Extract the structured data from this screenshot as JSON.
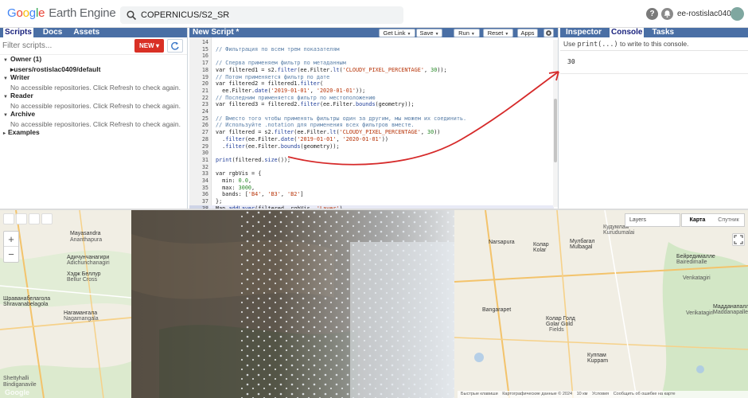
{
  "header": {
    "logo_letters": [
      "G",
      "o",
      "o",
      "g",
      "l",
      "e"
    ],
    "product": "Earth Engine",
    "search_value": "COPERNICUS/S2_SR",
    "user_name": "ee-rostislac0409",
    "help_icon": "help-icon",
    "notifications_icon": "bell-icon"
  },
  "left": {
    "tabs": [
      "Scripts",
      "Docs",
      "Assets"
    ],
    "filter_placeholder": "Filter scripts...",
    "new_button": "NEW",
    "tree": [
      {
        "type": "sec",
        "arrow": "▼",
        "label": "Owner (1)"
      },
      {
        "type": "item",
        "arrow": "▸",
        "label": "users/rostislac0409/default"
      },
      {
        "type": "sec",
        "arrow": "▼",
        "label": "Writer"
      },
      {
        "type": "empty",
        "label": "No accessible repositories. Click Refresh to check again."
      },
      {
        "type": "sec",
        "arrow": "▼",
        "label": "Reader"
      },
      {
        "type": "empty",
        "label": "No accessible repositories. Click Refresh to check again."
      },
      {
        "type": "sec",
        "arrow": "▼",
        "label": "Archive"
      },
      {
        "type": "empty",
        "label": "No accessible repositories. Click Refresh to check again."
      },
      {
        "type": "sec",
        "arrow": "▸",
        "label": "Examples"
      }
    ]
  },
  "editor": {
    "title": "New Script *",
    "buttons": {
      "get_link": "Get Link",
      "save": "Save",
      "run": "Run",
      "reset": "Reset",
      "apps": "Apps"
    },
    "lines": [
      {
        "n": "14",
        "segs": []
      },
      {
        "n": "15",
        "segs": [
          [
            "cm",
            "// Фильтрация по всем трем показателям"
          ]
        ]
      },
      {
        "n": "16",
        "segs": []
      },
      {
        "n": "17",
        "segs": [
          [
            "cm",
            "// Сперва применяем фильтр по метаданным"
          ]
        ]
      },
      {
        "n": "18",
        "segs": [
          [
            "kw",
            "var "
          ],
          [
            "var",
            "filtered1 = s2."
          ],
          [
            "fn",
            "filter"
          ],
          [
            "var",
            "(ee.Filter."
          ],
          [
            "fn",
            "lt"
          ],
          [
            "var",
            "("
          ],
          [
            "str",
            "'CLOUDY_PIXEL_PERCENTAGE'"
          ],
          [
            "var",
            ", "
          ],
          [
            "num",
            "30"
          ],
          [
            "var",
            "));"
          ]
        ]
      },
      {
        "n": "19",
        "segs": [
          [
            "cm",
            "// Потом применяется фильтр по дате"
          ]
        ]
      },
      {
        "n": "20",
        "segs": [
          [
            "kw",
            "var "
          ],
          [
            "var",
            "filtered2 = filtered1."
          ],
          [
            "fn",
            "filter"
          ],
          [
            "var",
            "("
          ]
        ]
      },
      {
        "n": "21",
        "segs": [
          [
            "var",
            "  ee.Filter."
          ],
          [
            "fn",
            "date"
          ],
          [
            "var",
            "("
          ],
          [
            "str",
            "'2019-01-01'"
          ],
          [
            "var",
            ", "
          ],
          [
            "str",
            "'2020-01-01'"
          ],
          [
            "var",
            "));"
          ]
        ]
      },
      {
        "n": "22",
        "segs": [
          [
            "cm",
            "// Последним применяется фильтр по местоположению"
          ]
        ]
      },
      {
        "n": "23",
        "segs": [
          [
            "kw",
            "var "
          ],
          [
            "var",
            "filtered3 = filtered2."
          ],
          [
            "fn",
            "filter"
          ],
          [
            "var",
            "(ee.Filter."
          ],
          [
            "fn",
            "bounds"
          ],
          [
            "var",
            "(geometry));"
          ]
        ]
      },
      {
        "n": "24",
        "segs": []
      },
      {
        "n": "25",
        "segs": [
          [
            "cm",
            "// Вместо того чтобы применять фильтры один за другим, мы можем их соединить."
          ]
        ]
      },
      {
        "n": "26",
        "segs": [
          [
            "cm",
            "// Используйте .notation для применения всех фильтров вместе."
          ]
        ]
      },
      {
        "n": "27",
        "segs": [
          [
            "kw",
            "var "
          ],
          [
            "var",
            "filtered = s2."
          ],
          [
            "fn",
            "filter"
          ],
          [
            "var",
            "(ee.Filter."
          ],
          [
            "fn",
            "lt"
          ],
          [
            "var",
            "("
          ],
          [
            "str",
            "'CLOUDY_PIXEL_PERCENTAGE'"
          ],
          [
            "var",
            ", "
          ],
          [
            "num",
            "30"
          ],
          [
            "var",
            "))"
          ]
        ]
      },
      {
        "n": "28",
        "segs": [
          [
            "var",
            "  ."
          ],
          [
            "fn",
            "filter"
          ],
          [
            "var",
            "(ee.Filter."
          ],
          [
            "fn",
            "date"
          ],
          [
            "var",
            "("
          ],
          [
            "str",
            "'2019-01-01'"
          ],
          [
            "var",
            ", "
          ],
          [
            "str",
            "'2020-01-01'"
          ],
          [
            "var",
            "))"
          ]
        ]
      },
      {
        "n": "29",
        "segs": [
          [
            "var",
            "  ."
          ],
          [
            "fn",
            "filter"
          ],
          [
            "var",
            "(ee.Filter."
          ],
          [
            "fn",
            "bounds"
          ],
          [
            "var",
            "(geometry));"
          ]
        ]
      },
      {
        "n": "30",
        "segs": []
      },
      {
        "n": "31",
        "segs": [
          [
            "fn",
            "print"
          ],
          [
            "var",
            "(filtered."
          ],
          [
            "fn",
            "size"
          ],
          [
            "var",
            "());"
          ]
        ]
      },
      {
        "n": "32",
        "segs": []
      },
      {
        "n": "33",
        "segs": [
          [
            "kw",
            "var "
          ],
          [
            "var",
            "rgbVis = {"
          ]
        ]
      },
      {
        "n": "34",
        "segs": [
          [
            "var",
            "  min: "
          ],
          [
            "num",
            "0.0"
          ],
          [
            "var",
            ","
          ]
        ]
      },
      {
        "n": "35",
        "segs": [
          [
            "var",
            "  max: "
          ],
          [
            "num",
            "3000"
          ],
          [
            "var",
            ","
          ]
        ]
      },
      {
        "n": "36",
        "segs": [
          [
            "var",
            "  bands: ["
          ],
          [
            "str",
            "'B4'"
          ],
          [
            "var",
            ", "
          ],
          [
            "str",
            "'B3'"
          ],
          [
            "var",
            ", "
          ],
          [
            "str",
            "'B2'"
          ],
          [
            "var",
            "]"
          ]
        ]
      },
      {
        "n": "37",
        "segs": [
          [
            "var",
            "};"
          ]
        ]
      },
      {
        "n": "38",
        "segs": [
          [
            "var",
            "Map."
          ],
          [
            "fn",
            "addLayer"
          ],
          [
            "var",
            "(filtered, rgbVis, "
          ],
          [
            "str",
            "'Layer'"
          ],
          [
            "var",
            ")"
          ]
        ],
        "current": true
      }
    ]
  },
  "right": {
    "tabs": [
      "Inspector",
      "Console",
      "Tasks"
    ],
    "hint_prefix": "Use ",
    "hint_code": "print(...)",
    "hint_suffix": " to write to this console.",
    "output": "30"
  },
  "map": {
    "layers_label": "Layers",
    "map_type": [
      "Карта",
      "Спутник"
    ],
    "labels_left": [
      {
        "t": "Mayasandra",
        "cls": "city"
      },
      {
        "t": "Ananthapura"
      },
      {
        "t": "Адичунчанагири",
        "cls": "city"
      },
      {
        "t": "Adichunchanagiri"
      },
      {
        "t": "Хэдж Беллур",
        "cls": "city"
      },
      {
        "t": "Bellur Cross"
      },
      {
        "t": "Шраванабелагола",
        "cls": "city"
      },
      {
        "t": "Shravanabelagola",
        "cls": "city"
      },
      {
        "t": "Нагамангала",
        "cls": "city"
      },
      {
        "t": "Nagamangala"
      },
      {
        "t": "Shettyhalli"
      },
      {
        "t": "Bindiganavile"
      }
    ],
    "labels_right": [
      {
        "t": "Narsapura",
        "cls": "city"
      },
      {
        "t": "Колар",
        "cls": "city"
      },
      {
        "t": "Kolar",
        "cls": "city"
      },
      {
        "t": "Мулбагал",
        "cls": "city"
      },
      {
        "t": "Mulbagal",
        "cls": "city"
      },
      {
        "t": "Кудумлам"
      },
      {
        "t": "Kurudumalai"
      },
      {
        "t": "Бейредималле",
        "cls": "city"
      },
      {
        "t": "Bairedimalle"
      },
      {
        "t": "Venkatagiri"
      },
      {
        "t": "Bangarapet",
        "cls": "city"
      },
      {
        "t": "Golar Gold",
        "cls": "city"
      },
      {
        "t": "Колар Голд",
        "cls": "city"
      },
      {
        "t": "Fields"
      },
      {
        "t": "Verikatagiri"
      },
      {
        "t": "Мадданапалле",
        "cls": "city"
      },
      {
        "t": "Maddanapalle"
      },
      {
        "t": "Kuppam",
        "cls": "city"
      },
      {
        "t": "Куппам",
        "cls": "city"
      }
    ],
    "footer": [
      "Быстрые клавиши",
      "Картографические данные © 2024",
      "10 км",
      "Условия",
      "Сообщить об ошибке на карте"
    ],
    "watermark": "Google"
  }
}
